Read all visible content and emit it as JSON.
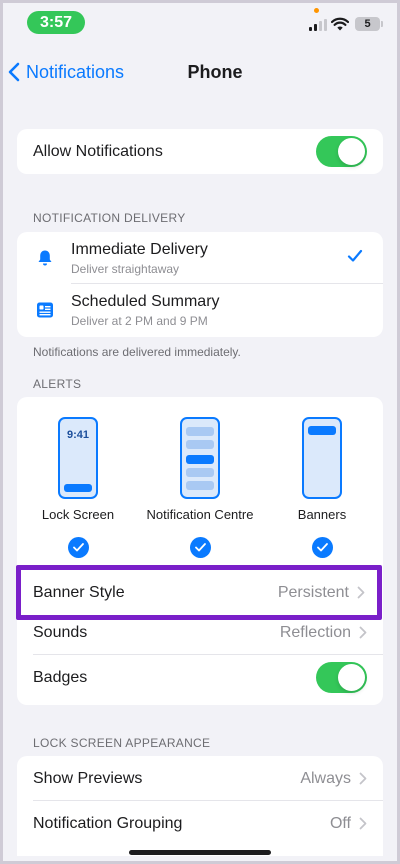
{
  "status_bar": {
    "time": "3:57",
    "battery": "5"
  },
  "nav": {
    "back_label": "Notifications",
    "title": "Phone"
  },
  "allow": {
    "label": "Allow Notifications",
    "enabled": true
  },
  "delivery": {
    "header": "NOTIFICATION DELIVERY",
    "items": [
      {
        "title": "Immediate Delivery",
        "subtitle": "Deliver straightaway",
        "icon": "bell-icon",
        "selected": true
      },
      {
        "title": "Scheduled Summary",
        "subtitle": "Deliver at 2 PM and 9 PM",
        "icon": "summary-icon",
        "selected": false
      }
    ],
    "footnote": "Notifications are delivered immediately."
  },
  "alerts": {
    "header": "ALERTS",
    "styles": [
      {
        "label": "Lock Screen",
        "preview_time": "9:41",
        "checked": true
      },
      {
        "label": "Notification Centre",
        "checked": true
      },
      {
        "label": "Banners",
        "checked": true
      }
    ],
    "rows": [
      {
        "label": "Banner Style",
        "value": "Persistent"
      },
      {
        "label": "Sounds",
        "value": "Reflection"
      },
      {
        "label": "Badges",
        "toggle": true
      }
    ]
  },
  "lock_screen": {
    "header": "LOCK SCREEN APPEARANCE",
    "rows": [
      {
        "label": "Show Previews",
        "value": "Always"
      },
      {
        "label": "Notification Grouping",
        "value": "Off"
      }
    ]
  },
  "colors": {
    "accent": "#0a7aff",
    "toggle_on": "#34c759",
    "highlight": "#7a1fc9"
  }
}
